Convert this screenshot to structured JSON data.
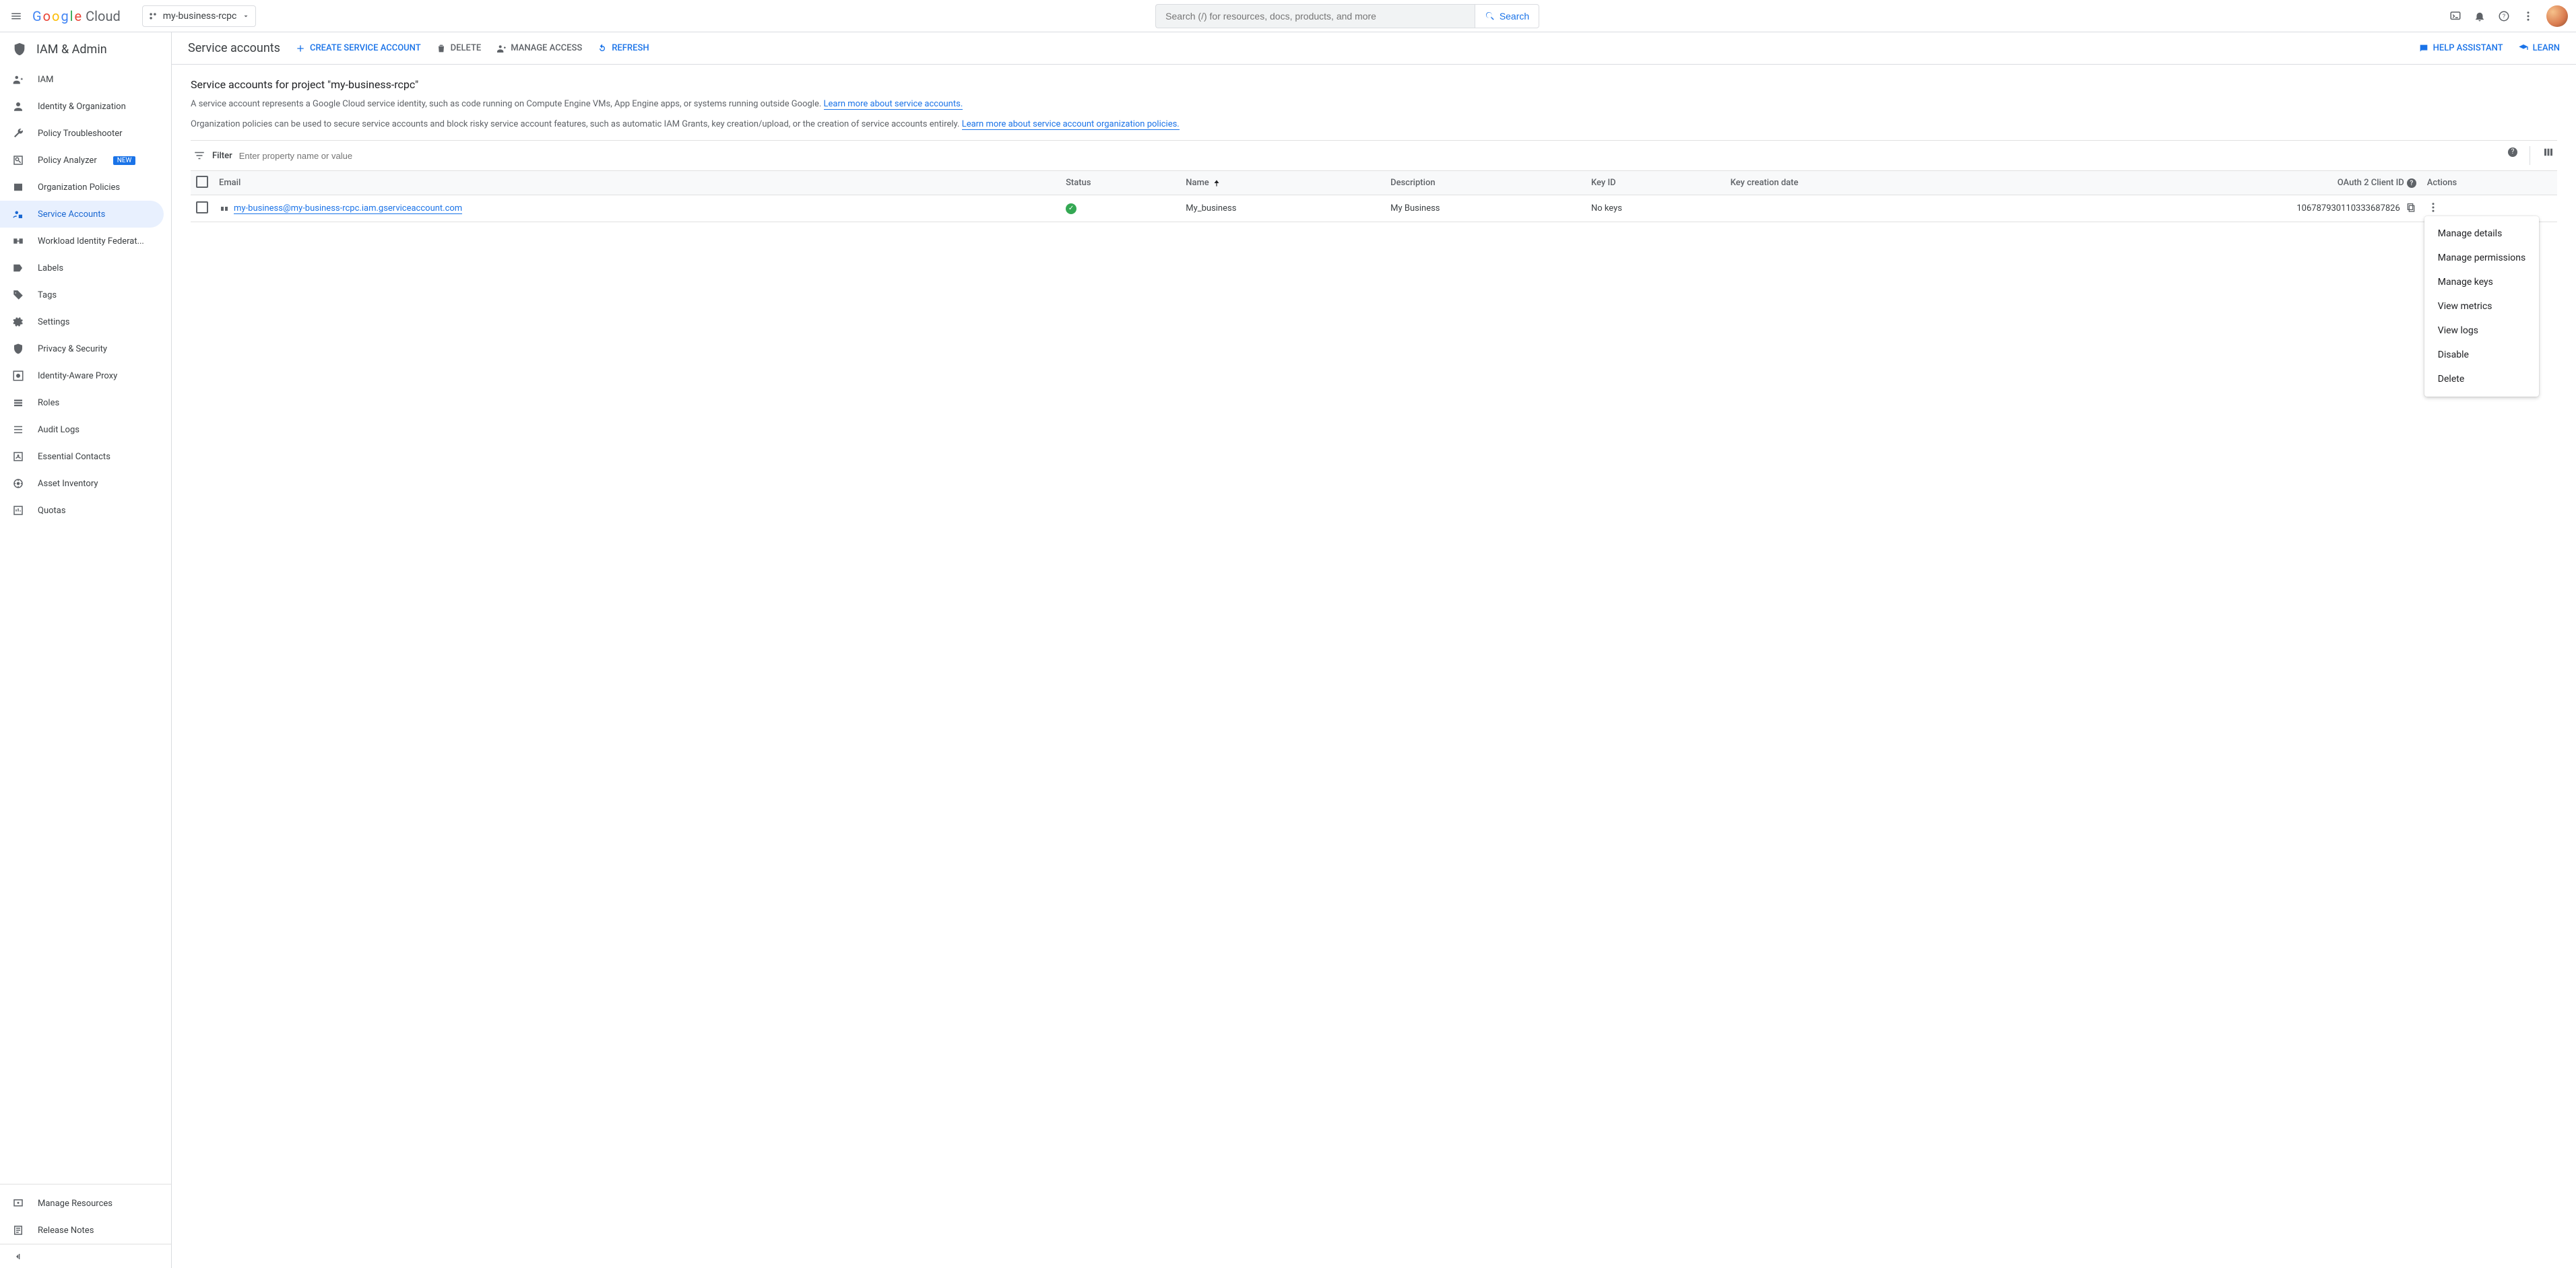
{
  "header": {
    "logo_cloud": "Cloud",
    "project_name": "my-business-rcpc",
    "search_placeholder": "Search (/) for resources, docs, products, and more",
    "search_button": "Search"
  },
  "sidebar": {
    "section_title": "IAM & Admin",
    "items": [
      {
        "icon": "iam",
        "label": "IAM"
      },
      {
        "icon": "identity",
        "label": "Identity & Organization"
      },
      {
        "icon": "wrench",
        "label": "Policy Troubleshooter"
      },
      {
        "icon": "analyzer",
        "label": "Policy Analyzer",
        "badge": "NEW"
      },
      {
        "icon": "org",
        "label": "Organization Policies"
      },
      {
        "icon": "sa",
        "label": "Service Accounts",
        "active": true
      },
      {
        "icon": "wif",
        "label": "Workload Identity Federat..."
      },
      {
        "icon": "label",
        "label": "Labels"
      },
      {
        "icon": "tag",
        "label": "Tags"
      },
      {
        "icon": "settings",
        "label": "Settings"
      },
      {
        "icon": "privacy",
        "label": "Privacy & Security"
      },
      {
        "icon": "iap",
        "label": "Identity-Aware Proxy"
      },
      {
        "icon": "roles",
        "label": "Roles"
      },
      {
        "icon": "audit",
        "label": "Audit Logs"
      },
      {
        "icon": "contacts",
        "label": "Essential Contacts"
      },
      {
        "icon": "asset",
        "label": "Asset Inventory"
      },
      {
        "icon": "quota",
        "label": "Quotas"
      }
    ],
    "footer": [
      {
        "icon": "manage",
        "label": "Manage Resources"
      },
      {
        "icon": "release",
        "label": "Release Notes"
      }
    ]
  },
  "subhead": {
    "title": "Service accounts",
    "actions": {
      "create": "CREATE SERVICE ACCOUNT",
      "delete": "DELETE",
      "manage_access": "MANAGE ACCESS",
      "refresh": "REFRESH",
      "help_assistant": "HELP ASSISTANT",
      "learn": "LEARN"
    }
  },
  "page": {
    "heading": "Service accounts for project \"my-business-rcpc\"",
    "desc1_a": "A service account represents a Google Cloud service identity, such as code running on Compute Engine VMs, App Engine apps, or systems running outside Google. ",
    "desc1_link": "Learn more about service accounts.",
    "desc2_a": "Organization policies can be used to secure service accounts and block risky service account features, such as automatic IAM Grants, key creation/upload, or the creation of service accounts entirely. ",
    "desc2_link": "Learn more about service account organization policies."
  },
  "filter": {
    "label": "Filter",
    "placeholder": "Enter property name or value"
  },
  "table": {
    "columns": {
      "email": "Email",
      "status": "Status",
      "name": "Name",
      "description": "Description",
      "keyid": "Key ID",
      "keydate": "Key creation date",
      "oauth": "OAuth 2 Client ID",
      "actions": "Actions"
    },
    "rows": [
      {
        "email": "my-business@my-business-rcpc.iam.gserviceaccount.com",
        "status": "ok",
        "name": "My_business",
        "description": "My Business",
        "keyid": "No keys",
        "keydate": "",
        "oauth": "106787930110333687826"
      }
    ]
  },
  "actions_menu": [
    "Manage details",
    "Manage permissions",
    "Manage keys",
    "View metrics",
    "View logs",
    "Disable",
    "Delete"
  ]
}
